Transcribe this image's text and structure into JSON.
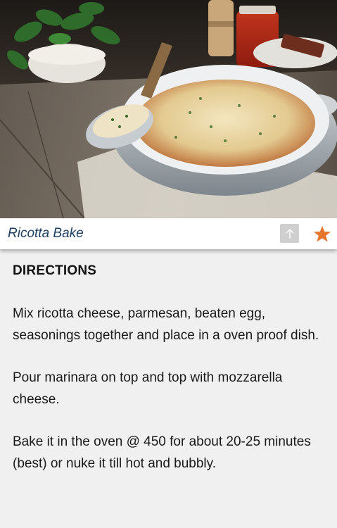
{
  "recipe": {
    "title": "Ricotta Bake",
    "image_icon": "photo-casserole"
  },
  "actions": {
    "share_icon": "arrow-up-icon",
    "favorite_icon": "star-icon",
    "favorite_color": "#e8762d"
  },
  "directions": {
    "heading": "DIRECTIONS",
    "steps": [
      "Mix ricotta cheese, parmesan, beaten egg, seasonings together and place in a oven proof dish.",
      "Pour marinara on top and top with mozzarella cheese.",
      "Bake it in the oven @ 450 for about 20-25 minutes (best) or nuke it till hot and bubbly."
    ]
  }
}
